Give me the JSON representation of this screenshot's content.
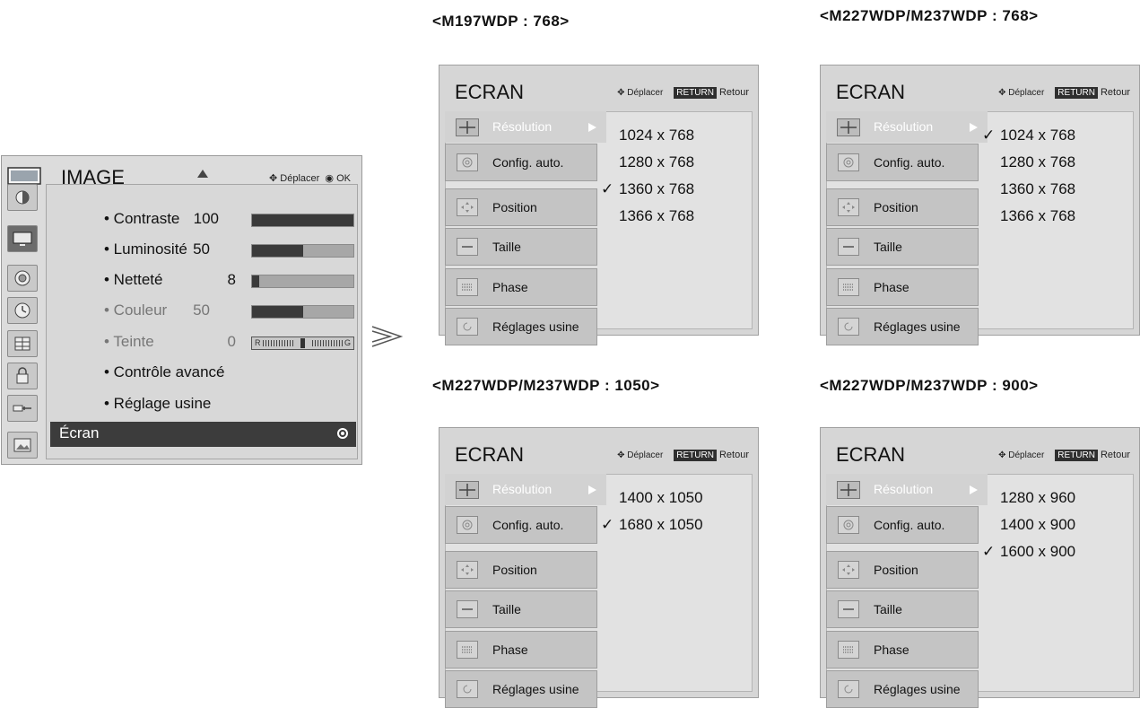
{
  "image_menu": {
    "title": "IMAGE",
    "nav_hint": "Déplacer",
    "ok_label": "OK",
    "rows": [
      {
        "name": "• Contraste",
        "value": "100",
        "level": 1.0
      },
      {
        "name": "• Luminosité",
        "value": "50",
        "level": 0.5
      },
      {
        "name": "• Netteté",
        "value": "8",
        "level": 0.07
      },
      {
        "name": "• Couleur",
        "value": "50",
        "level": 0.5
      },
      {
        "name": "• Teinte",
        "value": "0",
        "tint_left": "R",
        "tint_right": "G"
      },
      {
        "name": "• Contrôle avancé"
      },
      {
        "name": "• Réglage usine"
      }
    ],
    "selected": "Écran",
    "sidebar_icons": [
      "picture-mode-icon",
      "tv-icon",
      "speaker-icon",
      "clock-icon",
      "grid-icon",
      "lock-icon",
      "input-plug-icon",
      "photo-icon"
    ]
  },
  "panels": [
    {
      "caption": "<M197WDP : 768>",
      "title": "ECRAN",
      "nav": "Déplacer",
      "return_key": "RETURN",
      "return_label": "Retour",
      "resolution_label": "Résolution",
      "items": [
        "Config. auto.",
        "Position",
        "Taille",
        "Phase",
        "Réglages usine"
      ],
      "options": [
        {
          "text": "1024 x 768",
          "check": ""
        },
        {
          "text": "1280 x 768",
          "check": ""
        },
        {
          "text": "1360 x 768",
          "check": "✓"
        },
        {
          "text": "1366 x 768",
          "check": ""
        }
      ]
    },
    {
      "caption": "<M227WDP/M237WDP : 768>",
      "title": "ECRAN",
      "nav": "Déplacer",
      "return_key": "RETURN",
      "return_label": "Retour",
      "resolution_label": "Résolution",
      "items": [
        "Config. auto.",
        "Position",
        "Taille",
        "Phase",
        "Réglages usine"
      ],
      "options": [
        {
          "text": "1024 x 768",
          "check": "✓"
        },
        {
          "text": "1280 x 768",
          "check": ""
        },
        {
          "text": "1360 x 768",
          "check": ""
        },
        {
          "text": "1366 x 768",
          "check": ""
        }
      ]
    },
    {
      "caption": "<M227WDP/M237WDP : 1050>",
      "title": "ECRAN",
      "nav": "Déplacer",
      "return_key": "RETURN",
      "return_label": "Retour",
      "resolution_label": "Résolution",
      "items": [
        "Config. auto.",
        "Position",
        "Taille",
        "Phase",
        "Réglages usine"
      ],
      "options": [
        {
          "text": "1400 x 1050",
          "check": ""
        },
        {
          "text": "1680 x 1050",
          "check": "✓"
        }
      ]
    },
    {
      "caption": "<M227WDP/M237WDP : 900>",
      "title": "ECRAN",
      "nav": "Déplacer",
      "return_key": "RETURN",
      "return_label": "Retour",
      "resolution_label": "Résolution",
      "items": [
        "Config. auto.",
        "Position",
        "Taille",
        "Phase",
        "Réglages usine"
      ],
      "options": [
        {
          "text": "1280 x 960",
          "check": ""
        },
        {
          "text": "1400 x 900",
          "check": ""
        },
        {
          "text": "1600 x 900",
          "check": "✓"
        }
      ]
    }
  ]
}
